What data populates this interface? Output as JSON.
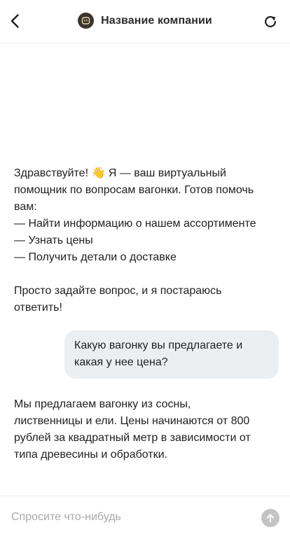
{
  "header": {
    "back_icon": "chevron-left-icon",
    "company_name": "Название компании",
    "logo_icon": "bot-icon",
    "refresh_icon": "refresh-icon"
  },
  "messages": [
    {
      "role": "bot",
      "lines": [
        "Здравствуйте! 👋 Я — ваш виртуальный",
        "помощник по вопросам вагонки. Готов помочь",
        "вам:",
        "— Найти информацию о нашем ассортименте",
        "— Узнать цены",
        "— Получить детали о доставке",
        "",
        "Просто задайте вопрос, и я постараюсь",
        "ответить!"
      ]
    },
    {
      "role": "user",
      "lines": [
        "Какую вагонку вы предлагаете и",
        "какая у нее цена?"
      ]
    },
    {
      "role": "bot",
      "lines": [
        "Мы предлагаем вагонку из сосны,",
        "лиственницы и ели. Цены начинаются от 800",
        "рублей за квадратный метр в зависимости от",
        "типа древесины и обработки."
      ]
    }
  ],
  "input": {
    "placeholder": "Спросите что-нибудь",
    "value": "",
    "send_icon": "arrow-up-icon"
  },
  "colors": {
    "user_bubble": "#eceff2",
    "send_button_disabled": "#c4c4c4",
    "logo_bg": "#3b3430"
  }
}
